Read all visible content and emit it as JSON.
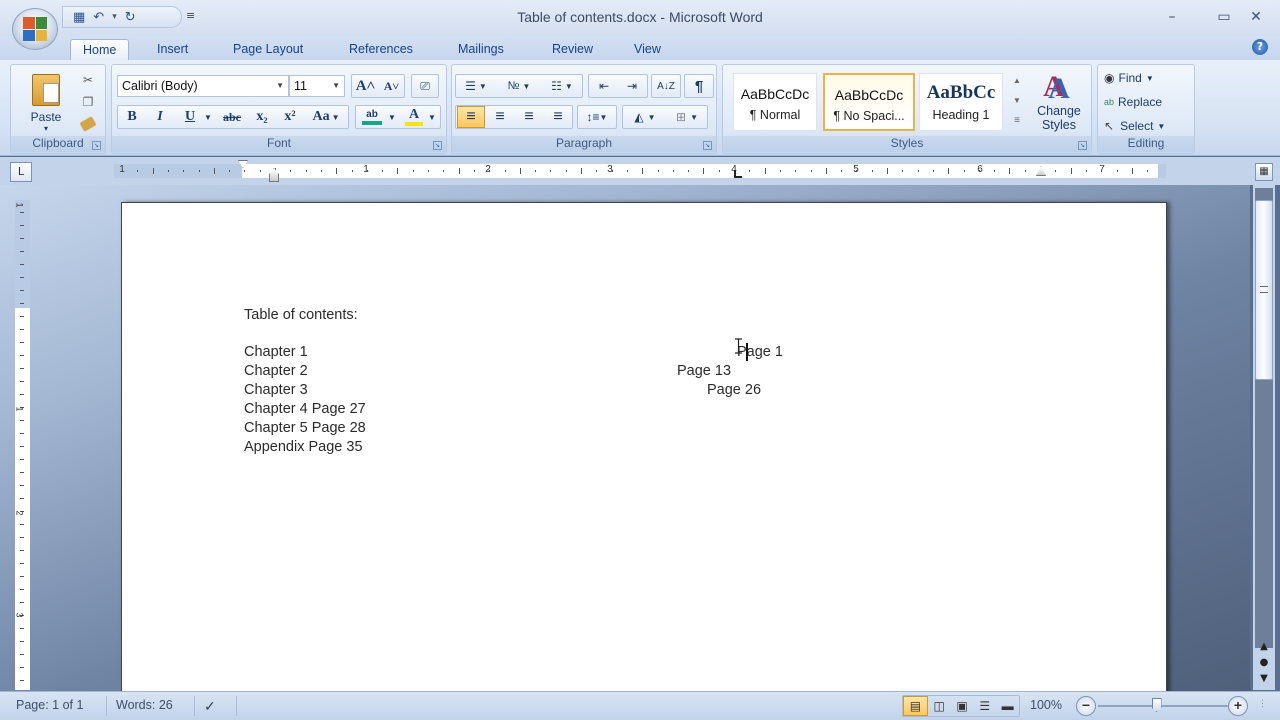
{
  "window": {
    "title": "Table of contents.docx - Microsoft Word",
    "minimize": "–",
    "maximize": "▭",
    "close": "✕"
  },
  "qat": {
    "save_icon": "💾",
    "undo_icon": "↶",
    "undo_dd": "▾",
    "redo_icon": "↻",
    "customize": "≡"
  },
  "tabs": [
    {
      "label": "Home",
      "active": true
    },
    {
      "label": "Insert"
    },
    {
      "label": "Page Layout"
    },
    {
      "label": "References"
    },
    {
      "label": "Mailings"
    },
    {
      "label": "Review"
    },
    {
      "label": "View"
    }
  ],
  "help_label": "?",
  "ribbon": {
    "clipboard": {
      "label": "Clipboard",
      "paste": "Paste",
      "paste_dd": "▾",
      "cut_icon": "✂",
      "copy_icon": "❐",
      "format_painter_icon": "🖌"
    },
    "font": {
      "label": "Font",
      "font_name": "Calibri (Body)",
      "font_size": "11",
      "grow": "A˄",
      "shrink": "A˅",
      "clear_format": "⎚",
      "bold": "B",
      "italic": "I",
      "underline": "U",
      "strikethrough": "abc",
      "subscript": "x₂",
      "superscript": "x²",
      "change_case": "Aa",
      "highlight": "ab",
      "font_color": "A",
      "highlight_color": "#17a589",
      "font_color_bar": "#f5e50a"
    },
    "paragraph": {
      "label": "Paragraph",
      "bullets": "☰",
      "numbering": "№",
      "multilevel": "☷",
      "decrease_indent": "⇤",
      "increase_indent": "⇥",
      "sort": "A↓Z",
      "show_marks": "¶",
      "align_left": "≡",
      "center": "≡",
      "align_right": "≡",
      "justify": "≡",
      "line_spacing": "↕≡",
      "shading": "◭",
      "borders": "⊞"
    },
    "styles": {
      "label": "Styles",
      "items": [
        {
          "sample": "AaBbCcDc",
          "name": "¶ Normal"
        },
        {
          "sample": "AaBbCcDc",
          "name": "¶ No Spaci...",
          "selected": true
        },
        {
          "sample": "AaBbCс",
          "name": "Heading 1"
        }
      ],
      "change_styles": "Change Styles",
      "change_styles_icon": "A"
    },
    "editing": {
      "label": "Editing",
      "find": "Find",
      "replace": "Replace",
      "select": "Select"
    }
  },
  "ruler": {
    "corner": "L",
    "numbers": [
      "1",
      "1",
      "2",
      "3",
      "4",
      "5",
      "6",
      "7"
    ],
    "vnumbers": [
      "1",
      "1",
      "2",
      "3"
    ]
  },
  "document": {
    "heading": "Table of contents:",
    "lines": [
      {
        "left": "Chapter 1",
        "right": "Page 1"
      },
      {
        "left": "Chapter 2",
        "right": "Page 13"
      },
      {
        "left": "Chapter 3",
        "right": "Page 26"
      },
      {
        "left": "Chapter 4 Page 27"
      },
      {
        "left": "Chapter 5 Page 28"
      },
      {
        "left": "Appendix Page 35"
      }
    ]
  },
  "statusbar": {
    "page": "Page: 1 of 1",
    "words": "Words: 26",
    "proofing_icon": "✓",
    "zoom_level": "100%",
    "zoom_out": "−",
    "zoom_in": "+",
    "zoom_percent": 100
  },
  "scroll": {
    "prev_page": "▲",
    "browse": "●",
    "next_page": "▼"
  }
}
